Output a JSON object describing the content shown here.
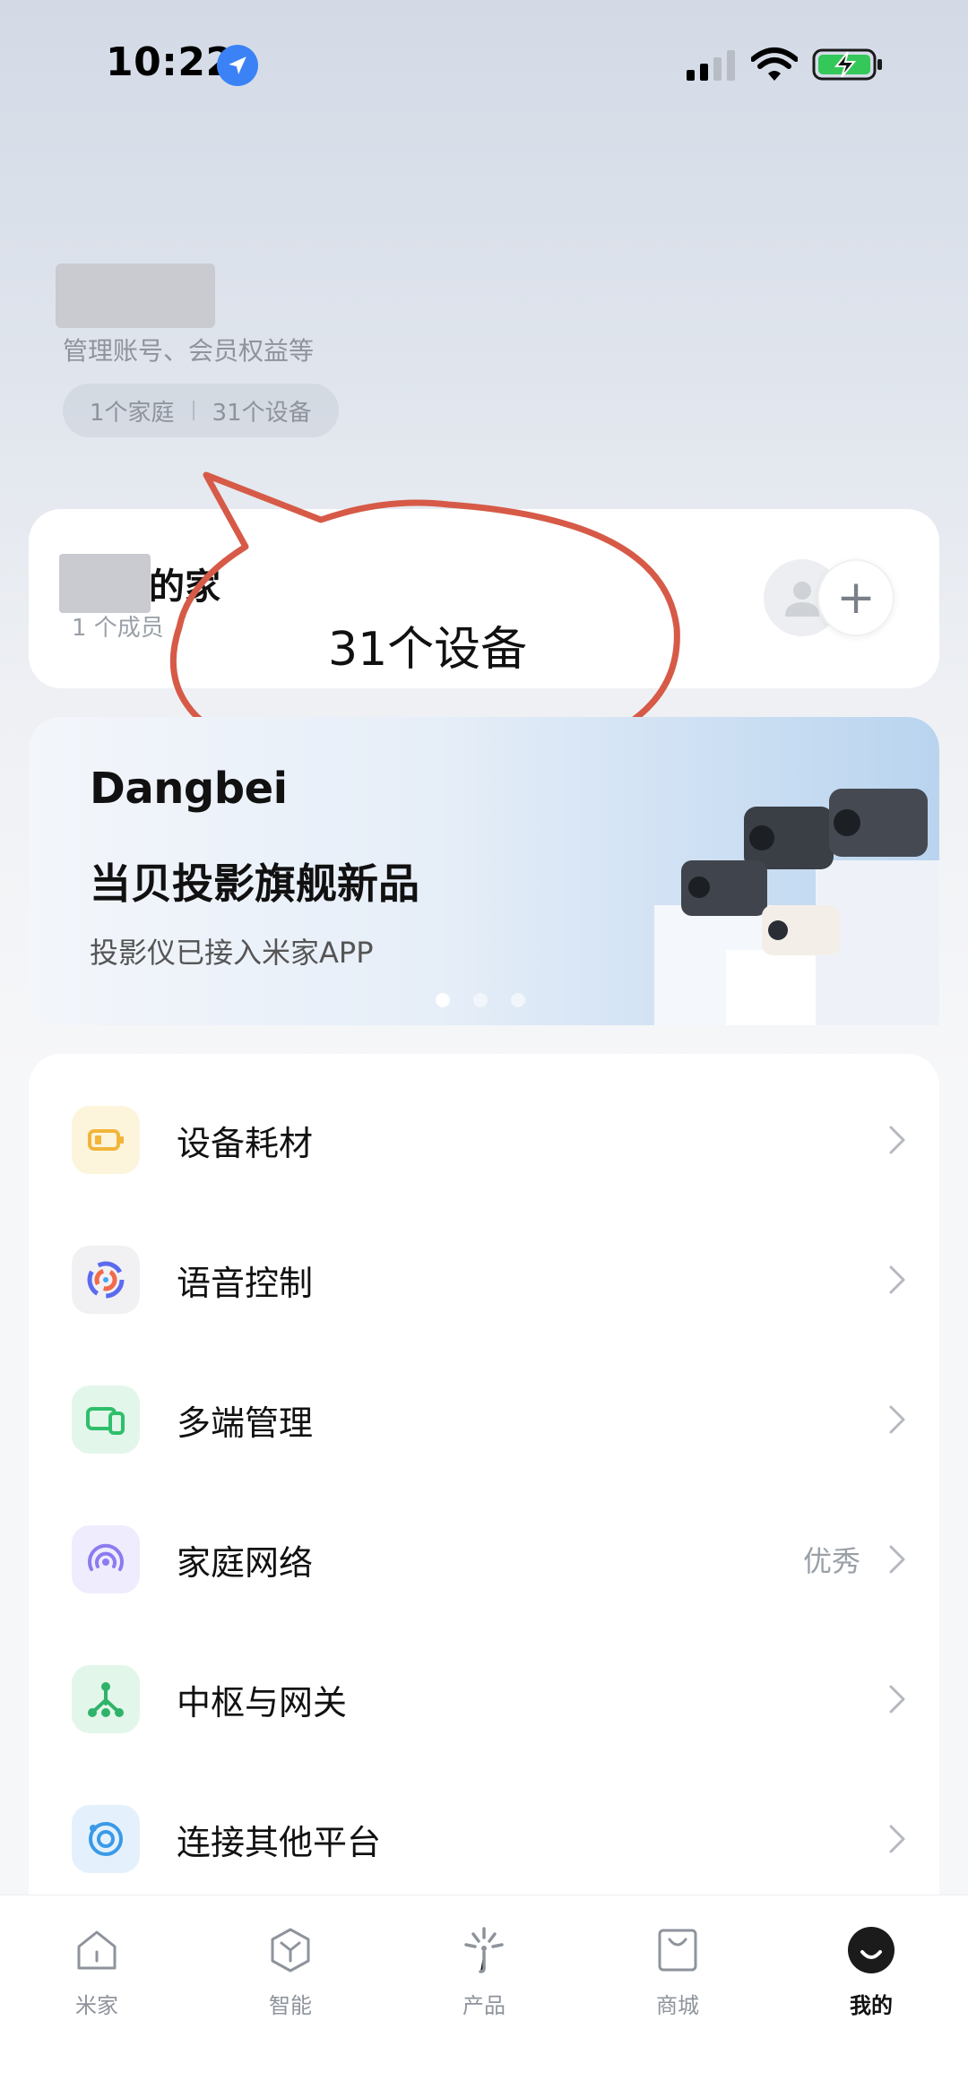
{
  "status_bar": {
    "time": "10:22"
  },
  "profile": {
    "subtitle": "管理账号、会员权益等",
    "family_count": "1个家庭",
    "device_count": "31个设备"
  },
  "home": {
    "name_suffix": "的家",
    "members": "1 个成员",
    "add_symbol": "+"
  },
  "callout": {
    "text": "31个设备",
    "color": "#d65a47"
  },
  "banner": {
    "brand": "Dangbei",
    "title": "当贝投影旗舰新品",
    "subtitle": "投影仪已接入米家APP",
    "pages": 3,
    "active_page": 1
  },
  "menu": {
    "items": [
      {
        "label": "设备耗材",
        "icon": "battery-icon",
        "value": "",
        "icon_bg": "#fdf4dc",
        "icon_color": "#f2b53a"
      },
      {
        "label": "语音控制",
        "icon": "voice-assistant-icon",
        "value": "",
        "icon_bg": "#f1f1f3",
        "icon_color": "#5b6bf0"
      },
      {
        "label": "多端管理",
        "icon": "multi-device-icon",
        "value": "",
        "icon_bg": "#e3f6ea",
        "icon_color": "#2fbf6b"
      },
      {
        "label": "家庭网络",
        "icon": "network-icon",
        "value": "优秀",
        "icon_bg": "#eeecfd",
        "icon_color": "#8b7bf0"
      },
      {
        "label": "中枢与网关",
        "icon": "hub-icon",
        "value": "",
        "icon_bg": "#e3f6ea",
        "icon_color": "#2fb36a"
      },
      {
        "label": "连接其他平台",
        "icon": "connect-platform-icon",
        "value": "",
        "icon_bg": "#e4f1fd",
        "icon_color": "#3a9ae8"
      }
    ]
  },
  "tabbar": {
    "tabs": [
      {
        "label": "米家",
        "icon": "home-icon",
        "active": false
      },
      {
        "label": "智能",
        "icon": "smart-icon",
        "active": false
      },
      {
        "label": "产品",
        "icon": "product-icon",
        "active": false
      },
      {
        "label": "商城",
        "icon": "shop-icon",
        "active": false
      },
      {
        "label": "我的",
        "icon": "profile-icon",
        "active": true
      }
    ]
  }
}
